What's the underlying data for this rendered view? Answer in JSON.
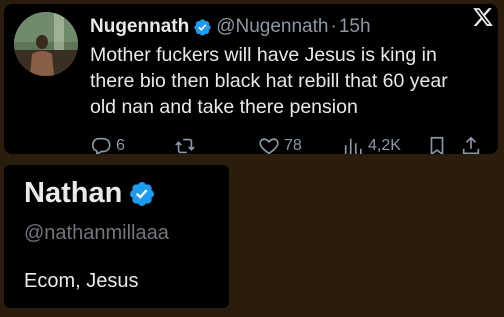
{
  "tweet": {
    "author_name": "Nugennath",
    "author_handle": "@Nugennath",
    "separator": "·",
    "time": "15h",
    "text_lines": [
      "Mother fuckers will have Jesus is king in",
      "there bio then black hat rebill that 60 year",
      "old nan and take there pension"
    ],
    "stats": {
      "replies": "6",
      "reposts": "",
      "likes": "78",
      "views": "4,2K"
    },
    "icons": {
      "reply": "reply-icon",
      "repost": "repost-icon",
      "like": "heart-icon",
      "views": "views-icon",
      "bookmark": "bookmark-icon",
      "share": "share-icon",
      "platform": "x-logo-icon",
      "verified": "verified-badge-icon"
    }
  },
  "profile": {
    "name": "Nathan",
    "handle": "@nathanmillaaa",
    "bio": "Ecom, Jesus"
  },
  "colors": {
    "background": "#2b1d0e",
    "card": "#000000",
    "text": "#e7e9ea",
    "muted": "#8b98a5",
    "verified": "#1d9bf0"
  }
}
